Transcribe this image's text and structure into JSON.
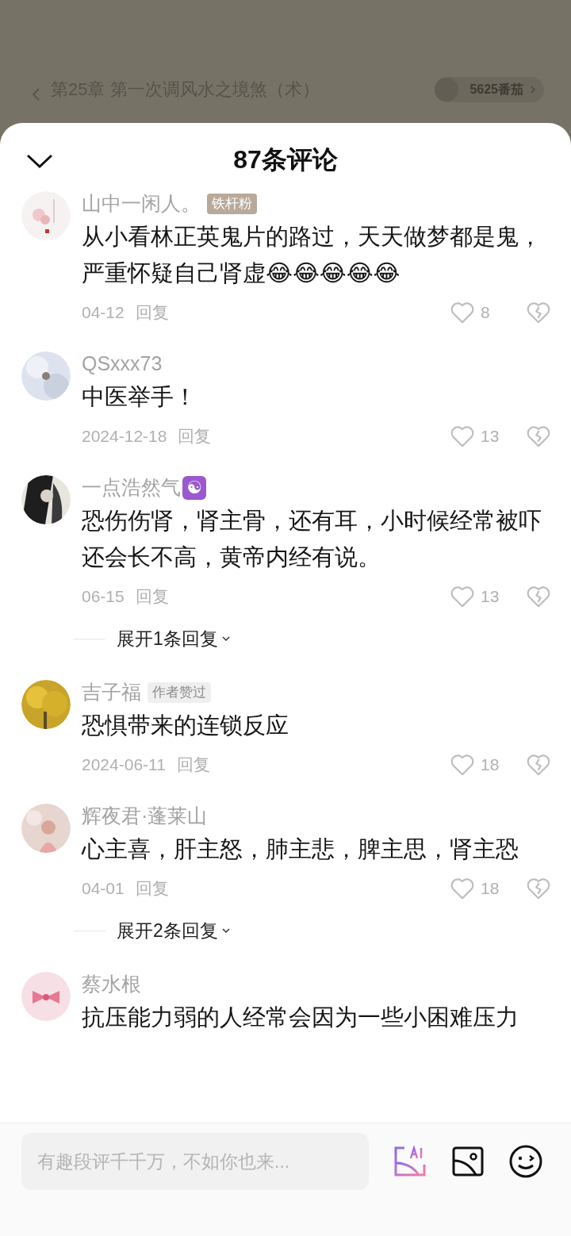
{
  "backdrop": {
    "chapter": "第25章 第一次调风水之境煞（术）",
    "coins": "5625番茄"
  },
  "sheet": {
    "title": "87条评论"
  },
  "comments": [
    {
      "name": "山中一闲人。",
      "badge": {
        "text": "铁杆粉",
        "kind": "fan"
      },
      "text": "从小看林正英鬼片的路过，天天做梦都是鬼，严重怀疑自己肾虚😂😂😂😂😂",
      "date": "04-12",
      "reply": "回复",
      "likes": "8"
    },
    {
      "name": "QSxxx73",
      "text": "中医举手！",
      "date": "2024-12-18",
      "reply": "回复",
      "likes": "13"
    },
    {
      "name": "一点浩然气",
      "name_emoji": "☯",
      "text": "恐伤伤肾，肾主骨，还有耳，小时候经常被吓还会长不高，黄帝内经有说。",
      "date": "06-15",
      "reply": "回复",
      "likes": "13",
      "expand": "展开1条回复"
    },
    {
      "name": "吉子福",
      "badge": {
        "text": "作者赞过",
        "kind": "author"
      },
      "text": "恐惧带来的连锁反应",
      "date": "2024-06-11",
      "reply": "回复",
      "likes": "18"
    },
    {
      "name": "辉夜君·蓬莱山",
      "text": "心主喜，肝主怒，肺主悲，脾主思，肾主恐",
      "date": "04-01",
      "reply": "回复",
      "likes": "18",
      "expand": "展开2条回复"
    },
    {
      "name": "蔡水根",
      "text": "抗压能力弱的人经常会因为一些小困难压力"
    }
  ],
  "composer": {
    "placeholder": "有趣段评千千万，不如你也来..."
  }
}
